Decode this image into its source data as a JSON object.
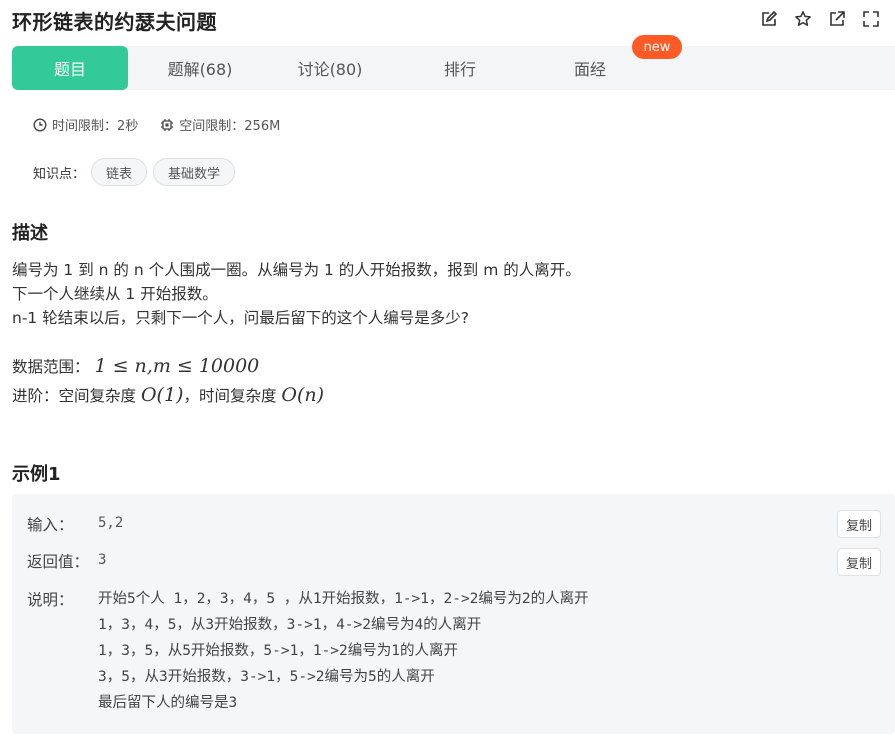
{
  "title": "环形链表的约瑟夫问题",
  "top_icons": [
    "edit-icon",
    "star-icon",
    "share-icon",
    "fullscreen-icon"
  ],
  "tabs": [
    {
      "label": "题目",
      "active": true
    },
    {
      "label": "题解(68)",
      "active": false
    },
    {
      "label": "讨论(80)",
      "active": false
    },
    {
      "label": "排行",
      "active": false
    },
    {
      "label": "面经",
      "active": false
    }
  ],
  "new_badge": "new",
  "limits": {
    "time": "时间限制：2秒",
    "memory": "空间限制：256M"
  },
  "knowledge": {
    "label": "知识点：",
    "tags": [
      "链表",
      "基础数学"
    ]
  },
  "description": {
    "heading": "描述",
    "lines": [
      "编号为 1 到 n 的 n 个人围成一圈。从编号为 1 的人开始报数，报到 m 的人离开。",
      "下一个人继续从 1 开始报数。",
      "n-1 轮结束以后，只剩下一个人，问最后留下的这个人编号是多少?"
    ],
    "range_label": "数据范围：",
    "range_math": "1 ≤ n,m ≤ 10000",
    "advanced_label": "进阶：空间复杂度",
    "space_math": "O(1)",
    "advanced_mid": "，时间复杂度",
    "time_math": "O(n)"
  },
  "example": {
    "heading": "示例1",
    "input_label": "输入：",
    "input_value": "5,2",
    "output_label": "返回值：",
    "output_value": "3",
    "explain_label": "说明：",
    "copy_label": "复制",
    "explain_lines": [
      "开始5个人 1，2，3，4，5 ，从1开始报数，1->1，2->2编号为2的人离开",
      "1，3，4，5，从3开始报数，3->1，4->2编号为4的人离开",
      "1，3，5，从5开始报数，5->1，1->2编号为1的人离开",
      "3，5，从3开始报数，3->1，5->2编号为5的人离开",
      "最后留下人的编号是3"
    ]
  },
  "colors": {
    "accent": "#32ca99",
    "badge": "#fd5a26"
  }
}
